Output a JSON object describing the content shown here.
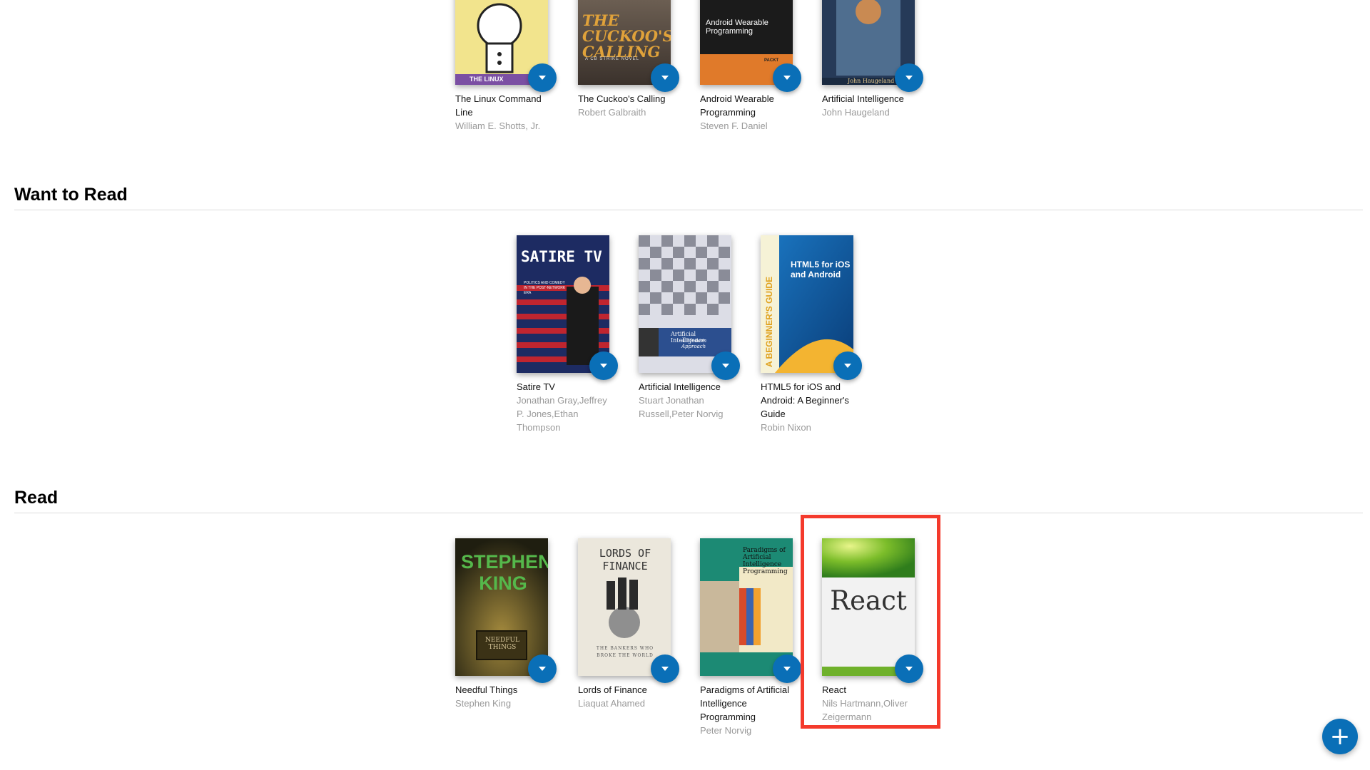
{
  "shelves": {
    "currently_reading": {
      "books": [
        {
          "title": "The Linux Command Line",
          "authors": "William E. Shotts, Jr.",
          "cover_text": "THE LINUX"
        },
        {
          "title": "The Cuckoo's Calling",
          "authors": "Robert Galbraith",
          "cover_text": "THE CUCKOO'S CALLING",
          "cover_sub": "A CB STRIKE NOVEL"
        },
        {
          "title": "Android Wearable Programming",
          "authors": "Steven F. Daniel",
          "cover_text": "Android Wearable Programming",
          "cover_badge": "PACKT"
        },
        {
          "title": "Artificial Intelligence",
          "authors": "John Haugeland",
          "cover_text": "John Haugeland"
        }
      ]
    },
    "want_to_read": {
      "title": "Want to Read",
      "books": [
        {
          "title": "Satire TV",
          "authors": "Jonathan Gray,Jeffrey P. Jones,Ethan Thompson",
          "cover_text": "SATIRE TV",
          "cover_sub": "POLITICS AND COMEDY IN THE POST-NETWORK ERA"
        },
        {
          "title": "Artificial Intelligence",
          "authors": "Stuart Jonathan Russell,Peter Norvig",
          "cover_text": "Artificial Intelligence",
          "cover_sub": "A Modern Approach"
        },
        {
          "title": "HTML5 for iOS and Android: A Beginner's Guide",
          "authors": "Robin Nixon",
          "cover_text": "HTML5 for iOS and Android",
          "cover_side": "A BEGINNER'S GUIDE"
        }
      ]
    },
    "read": {
      "title": "Read",
      "books": [
        {
          "title": "Needful Things",
          "authors": "Stephen King",
          "cover_text": "STEPHEN KING",
          "cover_sub": "NEEDFUL THINGS"
        },
        {
          "title": "Lords of Finance",
          "authors": "Liaquat Ahamed",
          "cover_text": "LORDS OF FINANCE",
          "cover_sub": "THE BANKERS WHO BROKE THE WORLD"
        },
        {
          "title": "Paradigms of Artificial Intelligence Programming",
          "authors": "Peter Norvig",
          "cover_text": "Paradigms of Artificial Intelligence Programming"
        },
        {
          "title": "React",
          "authors": "Nils Hartmann,Oliver Zeigermann",
          "cover_text": "React"
        }
      ]
    }
  },
  "add_button": {
    "label": "+"
  },
  "colors": {
    "accent": "#0a6fb7",
    "highlight": "#f43a2c",
    "author_text": "#999999"
  }
}
